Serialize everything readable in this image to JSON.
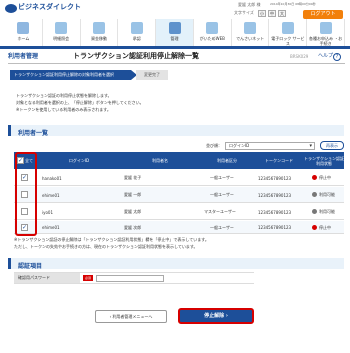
{
  "header": {
    "brand": "ビジネスダイレクト",
    "user": "愛媛 太郎 様",
    "last_login": "2014年10月30日 08時00分00秒",
    "font_size_label": "文字サイズ",
    "font_small": "小",
    "font_medium": "中",
    "font_large": "大",
    "logout": "ログアウト"
  },
  "nav": [
    {
      "label": "ホーム"
    },
    {
      "label": "明細照会"
    },
    {
      "label": "資金移動"
    },
    {
      "label": "承認"
    },
    {
      "label": "管理"
    },
    {
      "label": "がいためWEB"
    },
    {
      "label": "でんさいネット"
    },
    {
      "label": "電子ロック サービス"
    },
    {
      "label": "各種お申込み ・お手続き"
    }
  ],
  "title": {
    "left": "利用者管理",
    "main": "トランザクション認証利用停止解除一覧",
    "screen_id": "BRSK029",
    "help": "ヘルプ"
  },
  "steps": {
    "step1": "トランザクション認証利用停止解除の対象利用者を選択",
    "step2": "変更完了"
  },
  "description": [
    "トランザクション認証の利用停止状態を解除します。",
    "対象となる利用者を選択の上、「停止解除」ボタンを押してください。",
    "※トークンを使用している利用者のみ表示されます。"
  ],
  "user_list": {
    "section_title": "利用者一覧",
    "sort_label": "並び順：",
    "sort_value": "ログインID",
    "sort_button": "再表示",
    "columns": {
      "all": "全て",
      "login_id": "ログインID",
      "user_name": "利用者名",
      "user_type": "利用者区分",
      "token_code": "トークンコード",
      "status": "トランザクション認証利用状態"
    },
    "rows": [
      {
        "checked": "✓",
        "login_id": "hanako01",
        "name": "愛媛 花子",
        "type": "一般ユーザー",
        "token": "1234567890123",
        "status": "停止中"
      },
      {
        "checked": "",
        "login_id": "ehime01",
        "name": "愛媛 一郎",
        "type": "一般ユーザー",
        "token": "1234567890123",
        "status": "利用可能"
      },
      {
        "checked": "",
        "login_id": "iyo01",
        "name": "愛媛 太郎",
        "type": "マスターユーザー",
        "token": "1234567890123",
        "status": "利用可能"
      },
      {
        "checked": "✓",
        "login_id": "ehime01",
        "name": "愛媛 次郎",
        "type": "一般ユーザー",
        "token": "1234567890123",
        "status": "停止中"
      }
    ],
    "note1": "※トランザクション認証の停止解除は「トランザクション認証利用状態」欄を「停止中」で表示しています。",
    "note2": "ただし、トークンの失効やお手続きの方は、現在のトランザクション認証利用状態を表示しています。"
  },
  "auth": {
    "section_title": "認証項目",
    "password_label": "確認用パスワード",
    "required": "必須"
  },
  "buttons": {
    "back": "利用者管理メニューへ",
    "submit": "停止解除"
  },
  "colors": {
    "primary": "#1d4f99",
    "accent_orange": "#f2800b",
    "alert_red": "#d60000",
    "available_gray": "#777777"
  }
}
